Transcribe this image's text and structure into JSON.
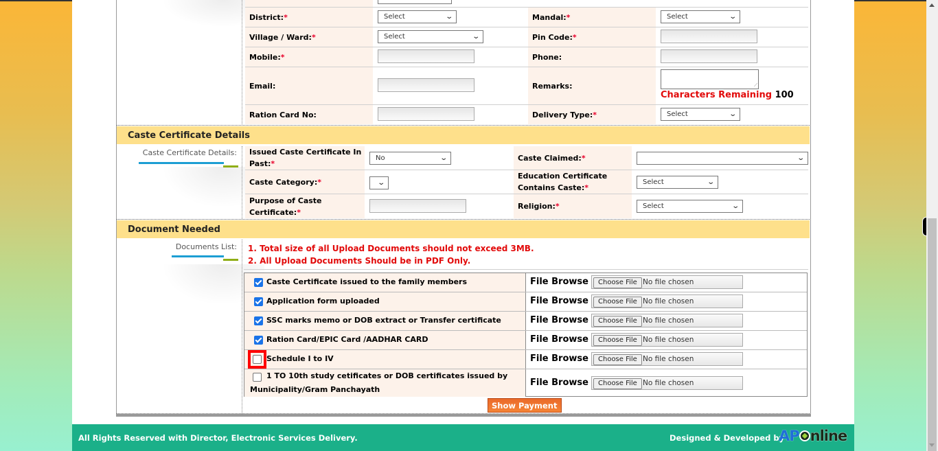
{
  "contact_section": {
    "fields_left": [
      {
        "label": "District:",
        "required": true,
        "type": "select",
        "value": "Select"
      },
      {
        "label": "Village / Ward:",
        "required": true,
        "type": "select",
        "value": "Select"
      },
      {
        "label": "Mobile:",
        "required": true,
        "type": "text",
        "value": ""
      },
      {
        "label": "Email:",
        "required": false,
        "type": "text",
        "value": ""
      },
      {
        "label": "Ration Card No:",
        "required": false,
        "type": "text",
        "value": ""
      }
    ],
    "fields_right": [
      {
        "label": "Mandal:",
        "required": true,
        "type": "select",
        "value": "Select"
      },
      {
        "label": "Pin Code:",
        "required": true,
        "type": "text",
        "value": ""
      },
      {
        "label": "Phone:",
        "required": false,
        "type": "text",
        "value": ""
      },
      {
        "label": "Remarks:",
        "required": false,
        "type": "textarea",
        "value": ""
      },
      {
        "label": "Delivery Type:",
        "required": true,
        "type": "select",
        "value": "Select"
      }
    ],
    "chars_remaining_label": "Characters Remaining",
    "chars_remaining_value": "100",
    "required_mark": "*"
  },
  "caste_section": {
    "header": "Caste Certificate Details",
    "side_label": "Caste Certificate Details:",
    "issued_past": {
      "label1": "Issued Caste Certificate In",
      "label2": "Past:",
      "value": "No"
    },
    "caste_category": {
      "label": "Caste Category:",
      "value": ""
    },
    "purpose": {
      "label1": "Purpose of Caste",
      "label2": "Certificate:",
      "value": ""
    },
    "caste_claimed": {
      "label": "Caste Claimed:",
      "value": ""
    },
    "edu_cert": {
      "label1": "Education Certificate",
      "label2": "Contains Caste:",
      "value": "Select"
    },
    "religion": {
      "label": "Religion:",
      "value": "Select"
    }
  },
  "documents_section": {
    "header": "Document Needed",
    "side_label": "Documents List:",
    "notes": [
      "1. Total size of all Upload Documents should not exceed 3MB.",
      "2. All Upload Documents Should be in PDF Only."
    ],
    "file_browse_label": "File Browse :",
    "choose_file_label": "Choose File",
    "no_file_label": "No file chosen",
    "documents": [
      {
        "name": "Caste Certificate issued to the family members",
        "checked": true
      },
      {
        "name": "Application form uploaded",
        "checked": true
      },
      {
        "name": "SSC marks memo or DOB extract or Transfer certificate",
        "checked": true
      },
      {
        "name": "Ration Card/EPIC Card /AADHAR CARD",
        "checked": true
      },
      {
        "name": "Schedule I to IV",
        "checked": false,
        "highlighted": true
      },
      {
        "name": "1 TO 10th study cetificates or DOB certificates issued by",
        "name_line2": "Municipality/Gram Panchayath",
        "checked": false
      }
    ]
  },
  "show_payment_label": "Show Payment",
  "footer": {
    "left": "All Rights Reserved with Director, Electronic Services Delivery.",
    "right_prefix": "Designed & Developed by",
    "logo_ap": "AP",
    "logo_online": "nline"
  },
  "colors": {
    "section_header": "#fee08b",
    "label_bg": "#fdf2ea",
    "required": "#e8002a",
    "note_red": "#e20a0a",
    "footer": "#1bb089",
    "button": "#f07a30",
    "highlight": "#ff0000"
  }
}
